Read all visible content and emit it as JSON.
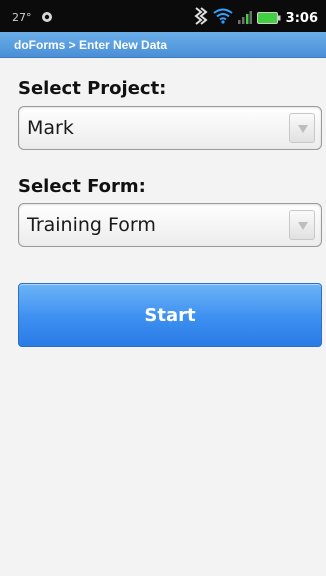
{
  "status_bar": {
    "temperature": "27°",
    "clock": "3:06",
    "icons": [
      "weather-icon",
      "vibrate-icon",
      "wifi-icon",
      "signal-icon",
      "battery-icon"
    ],
    "battery_color": "#3fd13f"
  },
  "title_bar": {
    "breadcrumb": "doForms > Enter New Data",
    "color": "#4a8fd6"
  },
  "project": {
    "label": "Select Project:",
    "value": "Mark"
  },
  "form": {
    "label": "Select Form:",
    "value": "Training Form"
  },
  "start_button": {
    "label": "Start",
    "color": "#3d8ff0"
  }
}
